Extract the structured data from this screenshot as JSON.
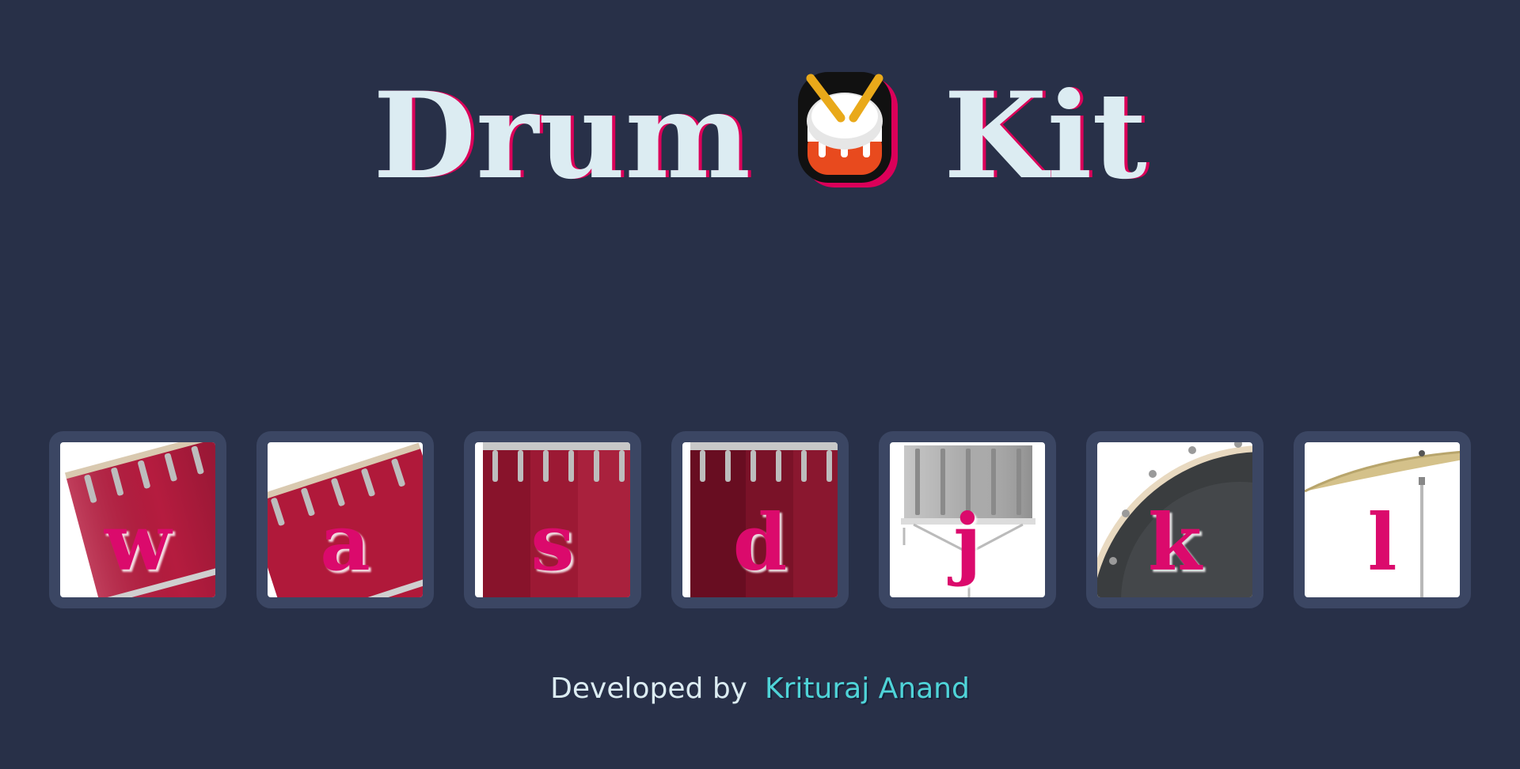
{
  "header": {
    "title_left": "Drum",
    "title_right": "Kit",
    "emoji_icon": "drum-icon"
  },
  "pads": [
    {
      "key": "w",
      "instrument": "tom-1"
    },
    {
      "key": "a",
      "instrument": "tom-2"
    },
    {
      "key": "s",
      "instrument": "tom-3"
    },
    {
      "key": "d",
      "instrument": "tom-4"
    },
    {
      "key": "j",
      "instrument": "snare"
    },
    {
      "key": "k",
      "instrument": "kick-bass"
    },
    {
      "key": "l",
      "instrument": "crash"
    }
  ],
  "footer": {
    "prefix": "Developed by",
    "author": "Krituraj Anand"
  },
  "colors": {
    "background": "#283048",
    "pad_border": "#3b4663",
    "key_text": "#db0a6c",
    "title_text": "#dcecf2",
    "title_shadow": "#db0059",
    "author_link": "#4fd4d8"
  }
}
